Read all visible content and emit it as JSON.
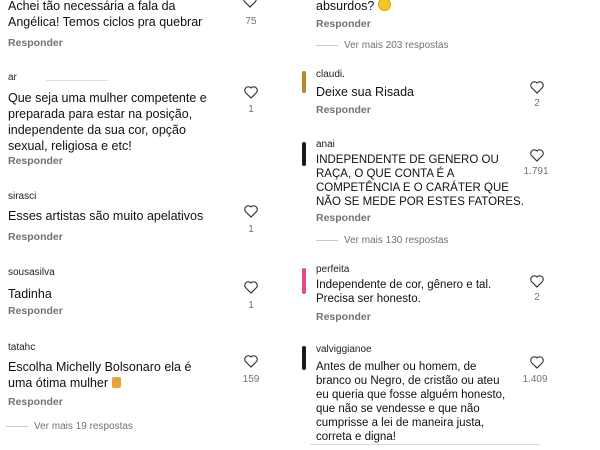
{
  "left": {
    "top_comment": {
      "text_line1": "Achei tão necessária a fala da",
      "text_line2": "Angélica! Temos ciclos pra quebrar",
      "likes": "75",
      "reply": "Responder"
    },
    "comments": [
      {
        "username": "ar",
        "lines": [
          "Que seja uma mulher competente e",
          "preparada para estar na posição,",
          "independente da sua cor, opção",
          "sexual, religiosa e etc!"
        ],
        "likes": "1",
        "reply": "Responder"
      },
      {
        "username": "sirasci",
        "lines": [
          "Esses artistas são muito apelativos"
        ],
        "likes": "1",
        "reply": "Responder"
      },
      {
        "username": "sousasilva",
        "lines": [
          "Tadinha"
        ],
        "likes": "1",
        "reply": "Responder"
      },
      {
        "username": "tatahc",
        "lines": [
          "Escolha Michelly Bolsonaro ela é",
          "uma ótima mulher"
        ],
        "likes": "159",
        "reply": "Responder"
      }
    ],
    "view_more": "Ver mais 19 respostas"
  },
  "right": {
    "top_comment": {
      "text": "absurdos?",
      "reply": "Responder",
      "view_more": "Ver mais 203 respostas"
    },
    "comments": [
      {
        "username": "claudi.",
        "lines": [
          "Deixe sua Risada"
        ],
        "likes": "2",
        "reply": "Responder"
      },
      {
        "username": "anai",
        "lines": [
          "INDEPENDENTE DE GENERO OU",
          "RAÇA, O QUE CONTA É A",
          "COMPETÊNCIA E O CARÁTER QUE",
          "NÃO SE MEDE POR ESTES FATORES."
        ],
        "likes": "1.791",
        "reply": "Responder",
        "view_more": "Ver mais 130 respostas"
      },
      {
        "username": "perfeita",
        "lines": [
          "Independente de cor, gênero e tal.",
          "Precisa ser honesto."
        ],
        "likes": "2",
        "reply": "Responder"
      },
      {
        "username": "valviggianoe",
        "lines": [
          "Antes de mulher ou homem, de",
          "branco ou Negro, de cristão ou ateu",
          "eu queria que fosse alguém honesto,",
          "que não se vendesse e que não",
          "cumprisse a lei de maneira justa,",
          "correta e digna!"
        ],
        "likes": "1.409"
      }
    ]
  },
  "icons": {
    "heart": "heart-outline-icon",
    "emoji_face": "smiling-face-emoji",
    "emoji_nail": "nail-polish-emoji"
  },
  "colors": {
    "secondary_text": "#737373",
    "avatar_dark": "#1a1a1a",
    "avatar_pink": "#e6478a",
    "avatar_gold": "#b8862b"
  }
}
